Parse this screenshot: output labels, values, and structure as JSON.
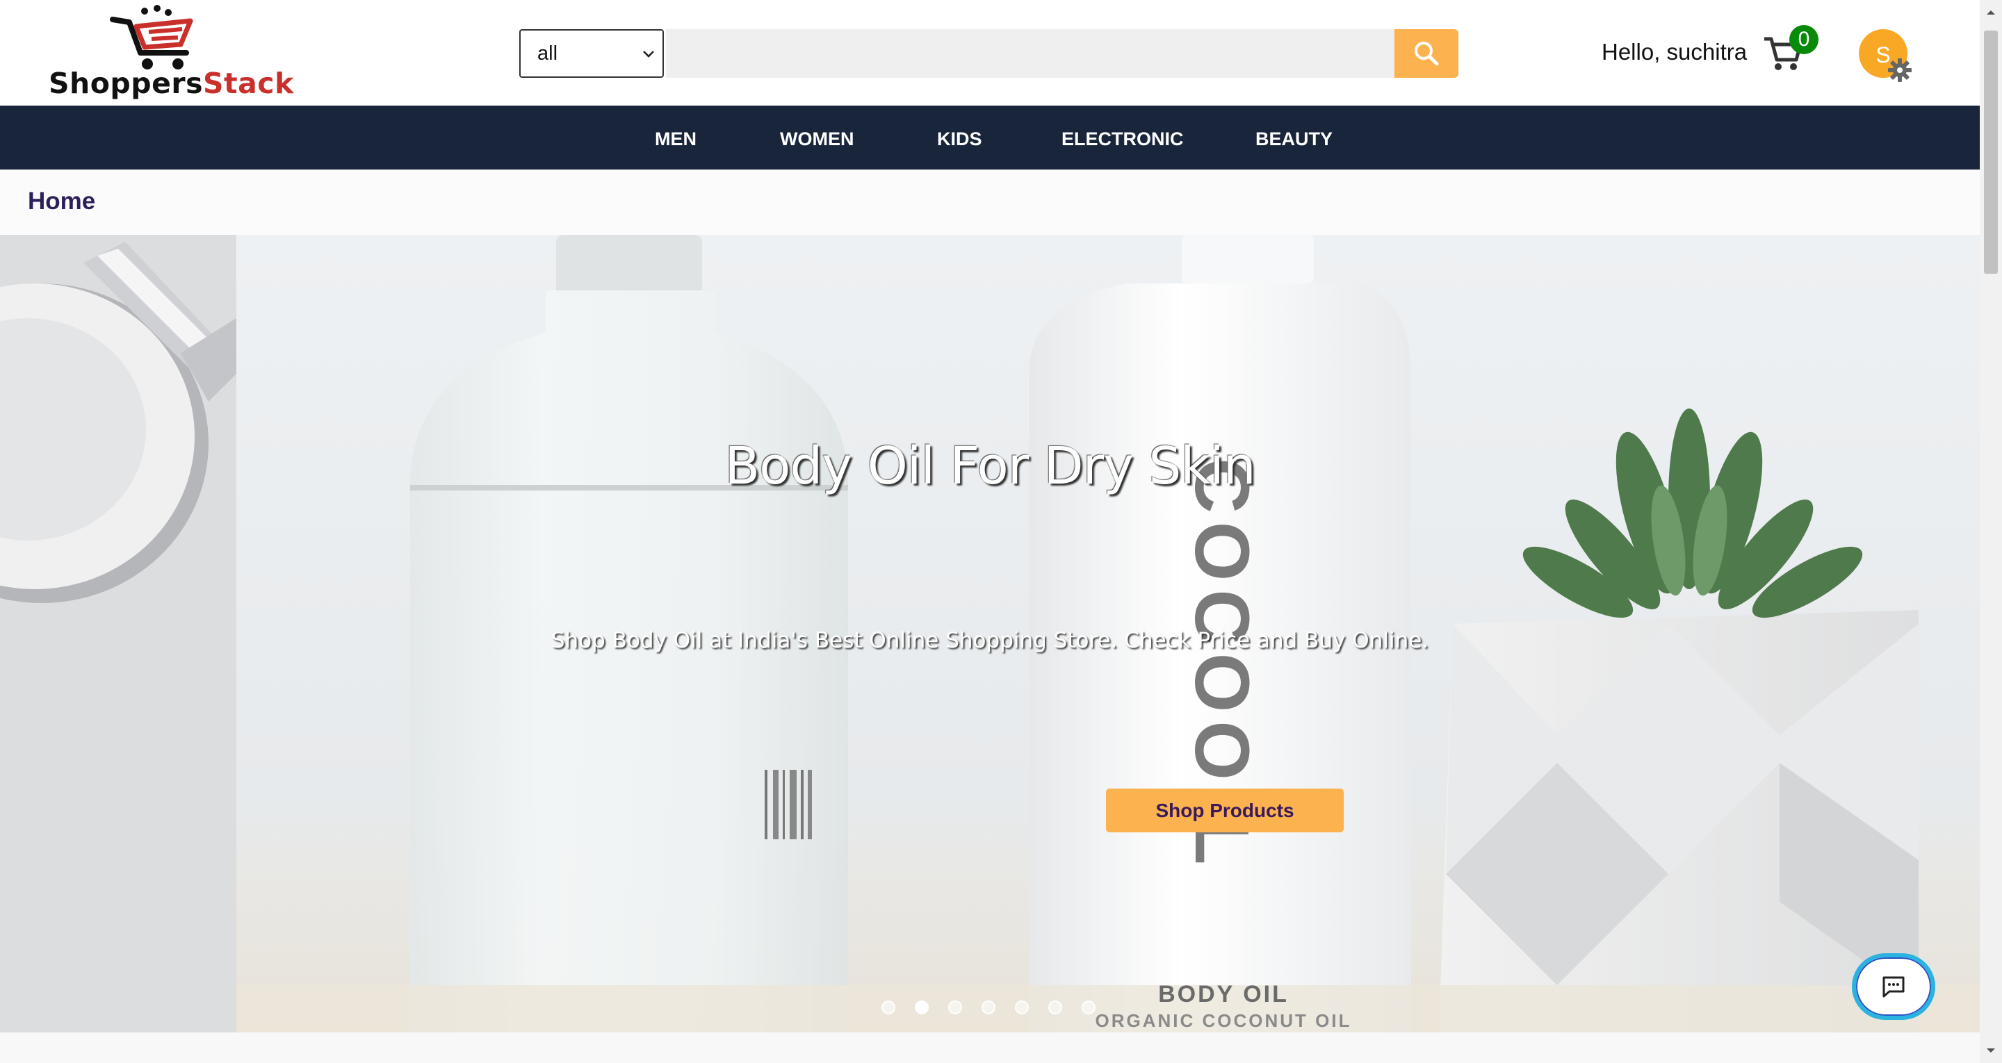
{
  "header": {
    "logo": {
      "text_main": "Shoppers",
      "text_accent": "Stack"
    },
    "search": {
      "category_value": "all",
      "query_value": "",
      "placeholder": ""
    },
    "greeting": "Hello, suchitra",
    "cart_count": "0",
    "avatar_initial": "S"
  },
  "nav": {
    "items": [
      {
        "label": "MEN"
      },
      {
        "label": "WOMEN"
      },
      {
        "label": "KIDS"
      },
      {
        "label": "ELECTRONIC"
      },
      {
        "label": "BEAUTY"
      }
    ]
  },
  "breadcrumb": "Home",
  "hero": {
    "title": "Body Oil For Dry Skin",
    "subtitle": "Shop Body Oil at India's Best Online Shopping Store. Check Price and Buy Online.",
    "button_label": "Shop Products",
    "bottle_brand": "COCOOIL",
    "bottle_line1": "BODY OIL",
    "bottle_line2": "ORGANIC COCONUT OIL",
    "slide_count": 7,
    "active_slide": 2
  },
  "colors": {
    "accent": "#fbb24f",
    "nav_bg": "#18253b",
    "cart_badge": "#0a8a0a",
    "logo_accent": "#c9302c",
    "breadcrumb_text": "#2d1f5c"
  },
  "icons": {
    "search": "search-icon",
    "cart": "cart-icon",
    "settings": "gear-icon",
    "chat": "chat-icon",
    "dropdown": "chevron-down-icon"
  }
}
